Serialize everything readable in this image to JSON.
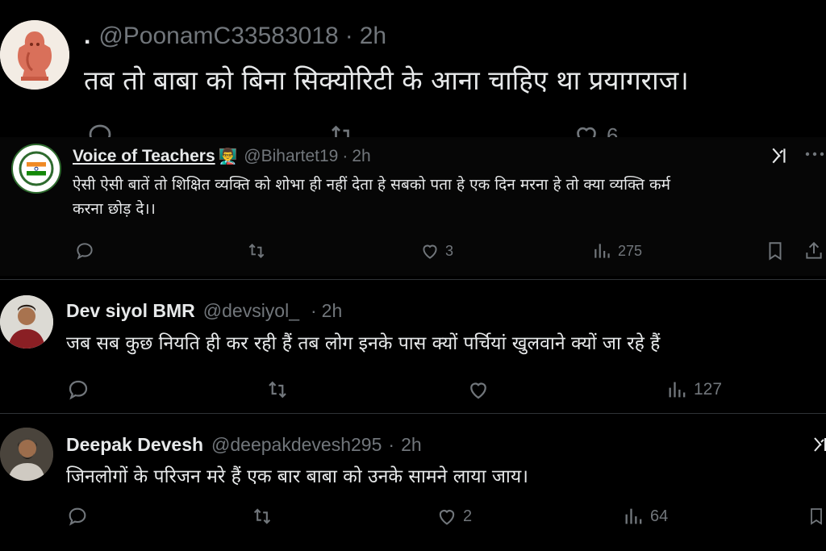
{
  "tweets": [
    {
      "handle": "@PoonamC33583018",
      "name_prefix": ".",
      "time": "2h",
      "text": "तब तो बाबा को बिना सिक्योरिटी के आना चाहिए था प्रयागराज।",
      "likes": "6",
      "icons": [
        "reply-icon",
        "retweet-icon",
        "like-icon"
      ]
    },
    {
      "name": "Voice of Teachers",
      "emoji": "👨‍🏫",
      "handle": "@Bihartet19",
      "time": "2h",
      "text_line1": "ऐसी ऐसी बातें तो शिक्षित व्यक्ति को शोभा ही नहीं देता हे सबको पता हे एक दिन मरना हे तो क्या व्यक्ति कर्म",
      "text_line2": "करना छोड़ दे।।",
      "likes": "3",
      "views": "275",
      "icons": [
        "reply-icon",
        "retweet-icon",
        "like-icon",
        "views-icon",
        "bookmark-icon",
        "share-icon",
        "grok-icon",
        "more-icon"
      ]
    },
    {
      "name": "Dev siyol BMR",
      "handle": "@devsiyol_",
      "time": "2h",
      "text": "जब सब कुछ नियति ही कर रही हैं तब लोग इनके पास क्यों पर्चियां खुलवाने क्यों जा रहे हैं",
      "views": "127",
      "icons": [
        "reply-icon",
        "retweet-icon",
        "like-icon",
        "views-icon"
      ]
    },
    {
      "name": "Deepak Devesh",
      "handle": "@deepakdevesh295",
      "time": "2h",
      "text": "जिनलोगों के परिजन मरे हैं एक बार बाबा को उनके सामने लाया जाय।",
      "likes": "2",
      "views": "64",
      "icons": [
        "reply-icon",
        "retweet-icon",
        "like-icon",
        "views-icon",
        "bookmark-icon"
      ]
    }
  ],
  "separator": "·",
  "colors": {
    "background": "#000000",
    "text": "#e7e9ea",
    "muted": "#71767b"
  }
}
